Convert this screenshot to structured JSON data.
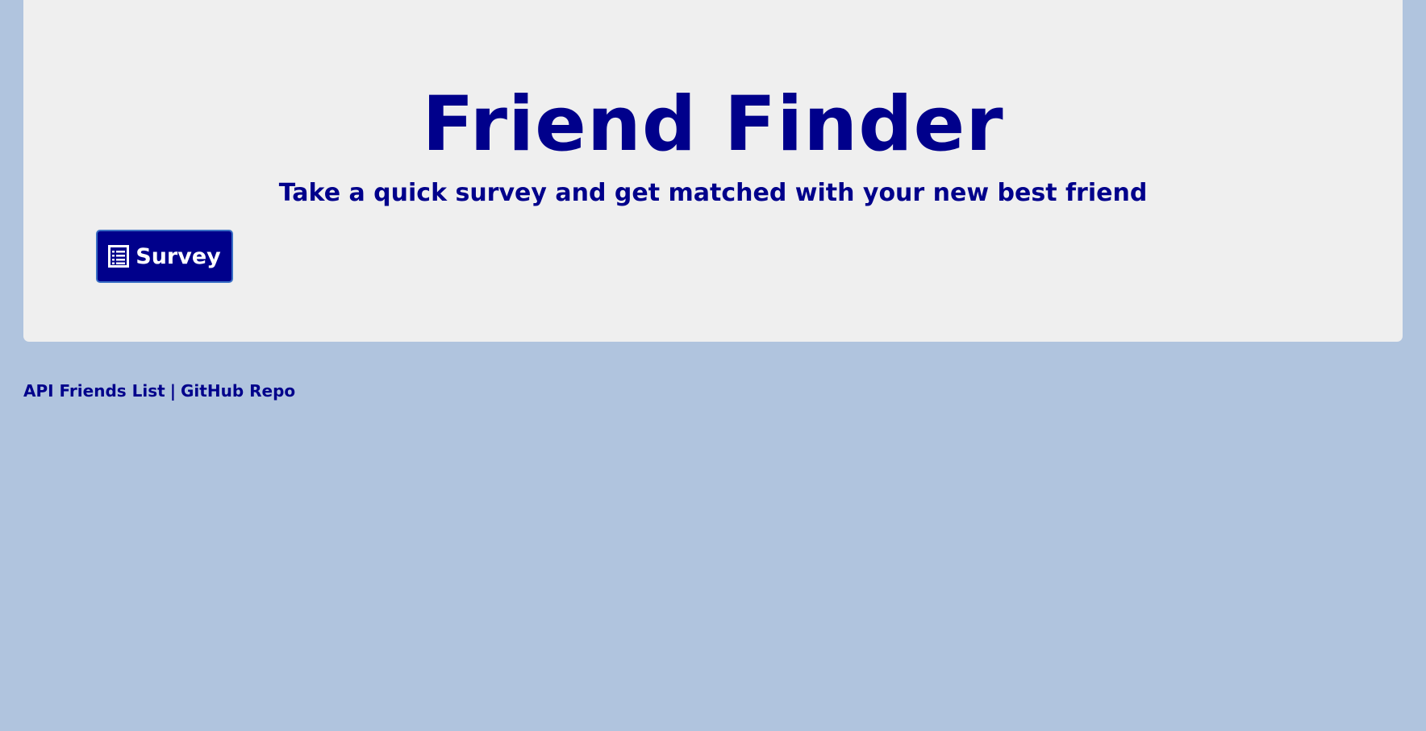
{
  "header": {
    "title": "Friend Finder",
    "subtitle": "Take a quick survey and get matched with your new best friend"
  },
  "survey_button": {
    "icon": "list-alt-icon",
    "label": "Survey"
  },
  "footer": {
    "links": [
      {
        "label": "API Friends List"
      },
      {
        "label": "GitHub Repo"
      }
    ],
    "separator": "|"
  },
  "colors": {
    "background": "#b0c4de",
    "panel": "#efefef",
    "accent": "#00008b",
    "button_text": "#ffffff"
  }
}
